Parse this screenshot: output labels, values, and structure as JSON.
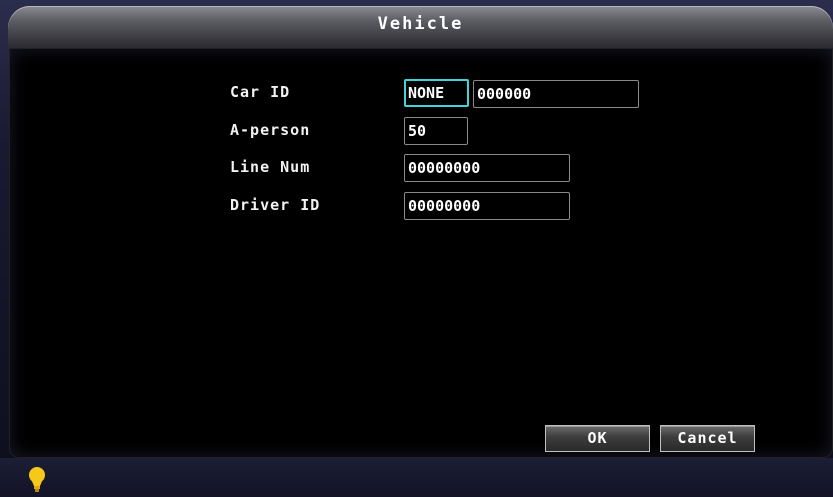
{
  "window": {
    "title": "Vehicle"
  },
  "form": {
    "car_id": {
      "label": "Car ID",
      "prefix": "NONE",
      "value": "000000"
    },
    "a_person": {
      "label": "A-person",
      "value": "50"
    },
    "line_num": {
      "label": "Line Num",
      "value": "00000000"
    },
    "driver_id": {
      "label": "Driver ID",
      "value": "00000000"
    }
  },
  "buttons": {
    "ok": "OK",
    "cancel": "Cancel"
  },
  "status": {
    "indicator_icon": "lightbulb-icon",
    "indicator_color": "#f7c81a"
  },
  "colors": {
    "focus": "#44d2d9",
    "panel": "#000000",
    "title_text": "#ffffff"
  }
}
